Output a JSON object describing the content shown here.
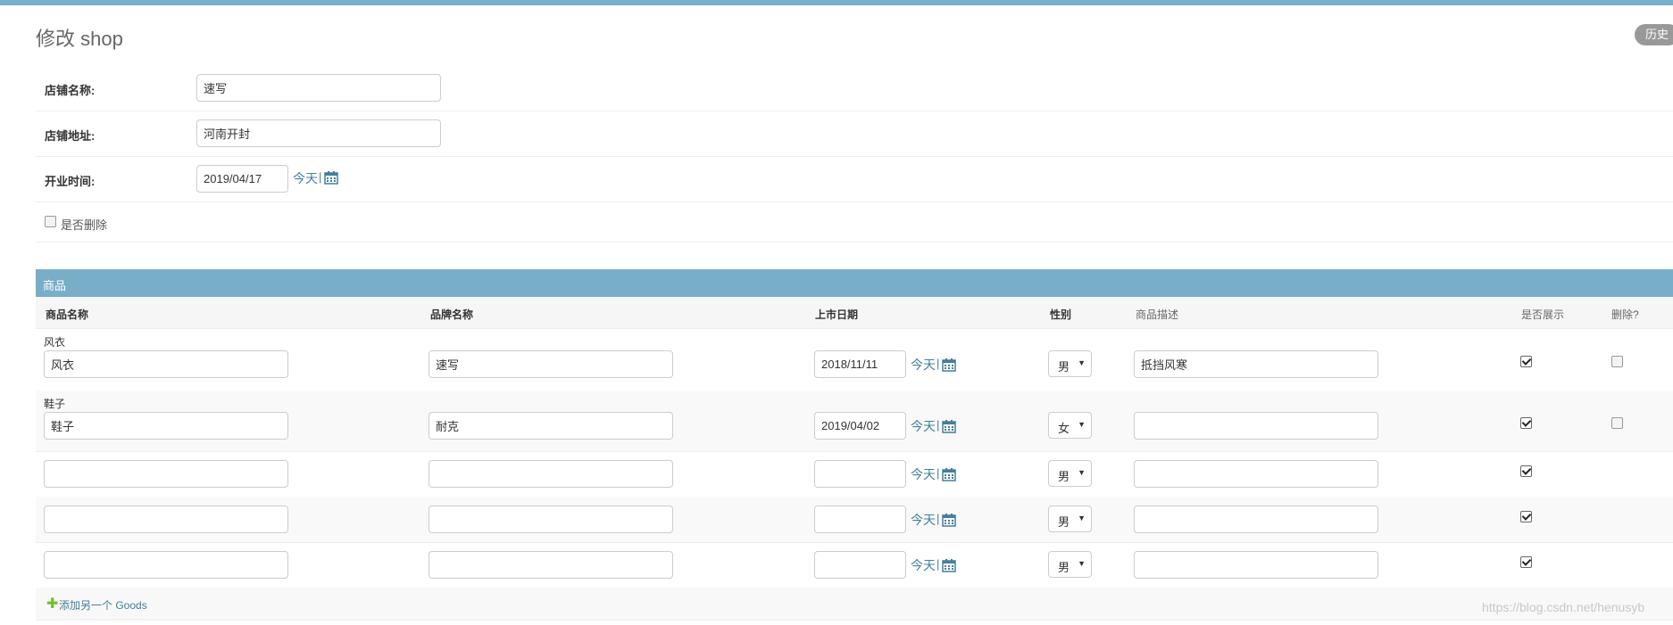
{
  "page": {
    "title": "修改 shop",
    "history_label": "历史"
  },
  "shop_form": {
    "name": {
      "label": "店铺名称:",
      "value": "速写"
    },
    "address": {
      "label": "店铺地址:",
      "value": "河南开封"
    },
    "opening_date": {
      "label": "开业时间:",
      "value": "2019/04/17",
      "today_label": "今天",
      "separator": "|"
    },
    "is_deleted": {
      "label": "是否删除",
      "checked": false
    }
  },
  "goods_inline": {
    "title": "商品",
    "columns": {
      "name": "商品名称",
      "brand": "品牌名称",
      "release_date": "上市日期",
      "gender": "性别",
      "description": "商品描述",
      "displayed": "是否展示",
      "delete": "删除?"
    },
    "today_label": "今天",
    "separator": "|",
    "rows": [
      {
        "original": "风衣",
        "name": "风衣",
        "brand": "速写",
        "date": "2018/11/11",
        "gender": "男",
        "description": "抵挡风寒",
        "displayed": true,
        "delete": false
      },
      {
        "original": "鞋子",
        "name": "鞋子",
        "brand": "耐克",
        "date": "2019/04/02",
        "gender": "女",
        "description": "",
        "displayed": true,
        "delete": false
      },
      {
        "original": "",
        "name": "",
        "brand": "",
        "date": "",
        "gender": "男",
        "description": "",
        "displayed": true
      },
      {
        "original": "",
        "name": "",
        "brand": "",
        "date": "",
        "gender": "男",
        "description": "",
        "displayed": true
      },
      {
        "original": "",
        "name": "",
        "brand": "",
        "date": "",
        "gender": "男",
        "description": "",
        "displayed": true
      }
    ],
    "add_another": "添加另一个 Goods"
  },
  "watermark": "https://blog.csdn.net/henusyb",
  "colors": {
    "header_bar": "#79aec8",
    "link": "#447e9b",
    "add_icon": "#70bf2b"
  },
  "icons": {
    "calendar": "calendar-icon",
    "add": "plus-icon"
  }
}
